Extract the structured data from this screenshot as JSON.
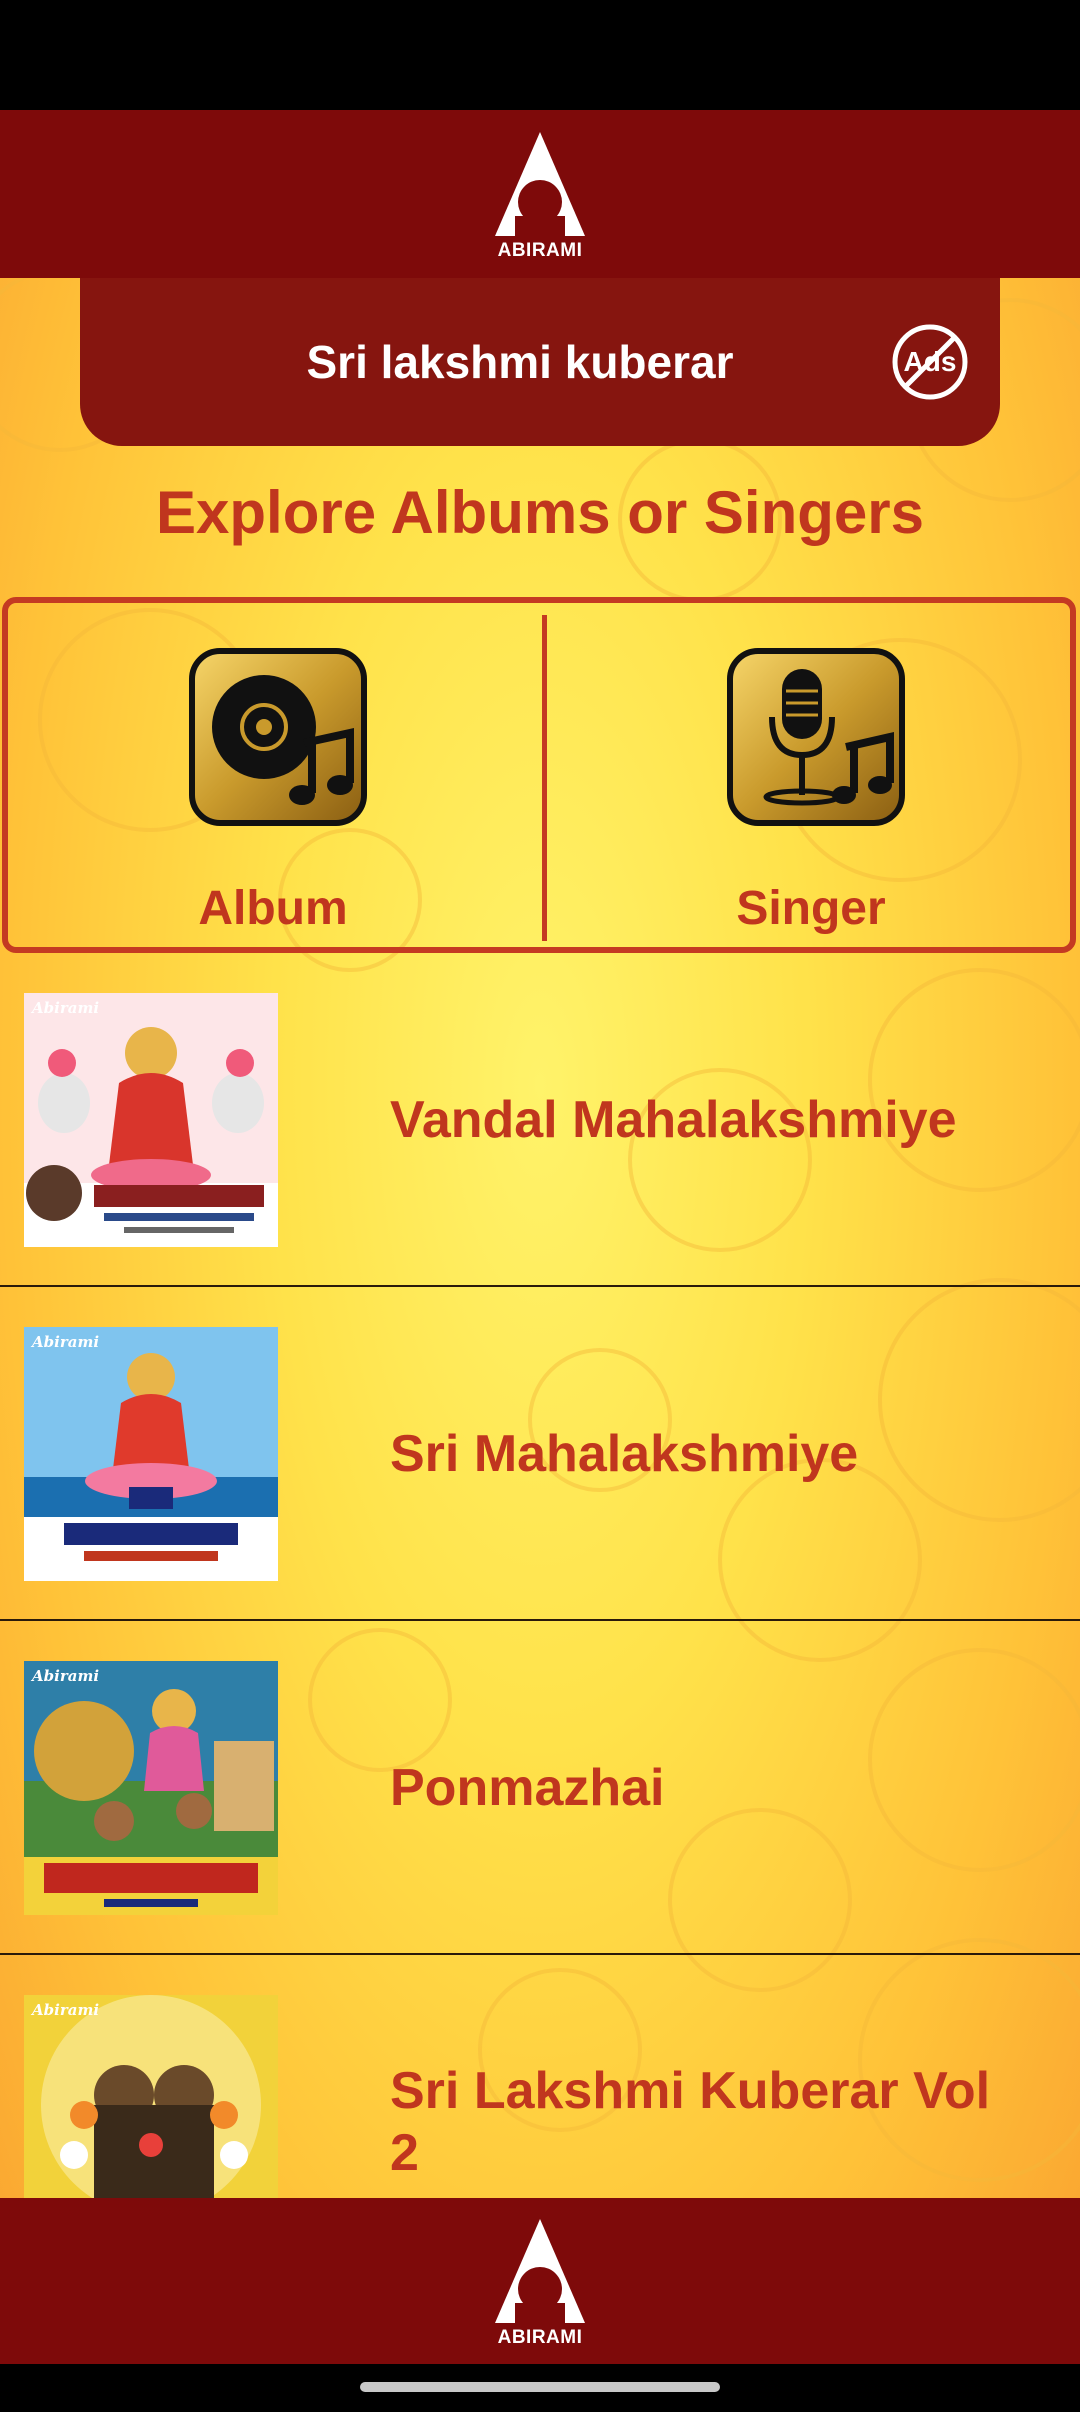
{
  "header": {
    "logo_text": "ABIRAMI",
    "logo_icon": "abirami-logo-icon"
  },
  "title_panel": {
    "title": "Sri lakshmi kuberar",
    "ads_label": "Ads",
    "ads_icon": "no-ads-icon"
  },
  "explore": {
    "heading": "Explore Albums or Singers"
  },
  "selector": {
    "options": [
      {
        "label": "Album",
        "icon": "album-disc-music-icon"
      },
      {
        "label": "Singer",
        "icon": "microphone-music-icon"
      }
    ]
  },
  "albums": [
    {
      "name": "Vandal Mahalakshmiye",
      "cover_brand": "Abirami"
    },
    {
      "name": "Sri Mahalakshmiye",
      "cover_brand": "Abirami"
    },
    {
      "name": "Ponmazhai",
      "cover_brand": "Abirami"
    },
    {
      "name": "Sri Lakshmi Kuberar Vol 2",
      "cover_brand": "Abirami"
    }
  ],
  "footer": {
    "logo_text": "ABIRAMI",
    "logo_icon": "abirami-logo-icon"
  },
  "colors": {
    "header_bg": "#7e0a0a",
    "panel_bg": "#86150f",
    "accent_text": "#c0361e",
    "background_yellow": "#ffe24a"
  }
}
